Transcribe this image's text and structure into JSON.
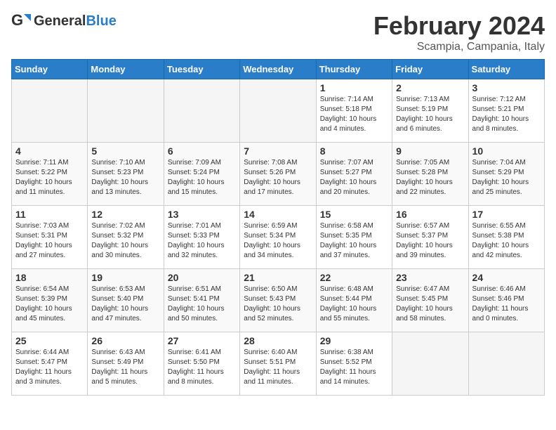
{
  "logo": {
    "text_general": "General",
    "text_blue": "Blue"
  },
  "title": "February 2024",
  "subtitle": "Scampia, Campania, Italy",
  "headers": [
    "Sunday",
    "Monday",
    "Tuesday",
    "Wednesday",
    "Thursday",
    "Friday",
    "Saturday"
  ],
  "weeks": [
    [
      {
        "day": "",
        "detail": ""
      },
      {
        "day": "",
        "detail": ""
      },
      {
        "day": "",
        "detail": ""
      },
      {
        "day": "",
        "detail": ""
      },
      {
        "day": "1",
        "detail": "Sunrise: 7:14 AM\nSunset: 5:18 PM\nDaylight: 10 hours\nand 4 minutes."
      },
      {
        "day": "2",
        "detail": "Sunrise: 7:13 AM\nSunset: 5:19 PM\nDaylight: 10 hours\nand 6 minutes."
      },
      {
        "day": "3",
        "detail": "Sunrise: 7:12 AM\nSunset: 5:21 PM\nDaylight: 10 hours\nand 8 minutes."
      }
    ],
    [
      {
        "day": "4",
        "detail": "Sunrise: 7:11 AM\nSunset: 5:22 PM\nDaylight: 10 hours\nand 11 minutes."
      },
      {
        "day": "5",
        "detail": "Sunrise: 7:10 AM\nSunset: 5:23 PM\nDaylight: 10 hours\nand 13 minutes."
      },
      {
        "day": "6",
        "detail": "Sunrise: 7:09 AM\nSunset: 5:24 PM\nDaylight: 10 hours\nand 15 minutes."
      },
      {
        "day": "7",
        "detail": "Sunrise: 7:08 AM\nSunset: 5:26 PM\nDaylight: 10 hours\nand 17 minutes."
      },
      {
        "day": "8",
        "detail": "Sunrise: 7:07 AM\nSunset: 5:27 PM\nDaylight: 10 hours\nand 20 minutes."
      },
      {
        "day": "9",
        "detail": "Sunrise: 7:05 AM\nSunset: 5:28 PM\nDaylight: 10 hours\nand 22 minutes."
      },
      {
        "day": "10",
        "detail": "Sunrise: 7:04 AM\nSunset: 5:29 PM\nDaylight: 10 hours\nand 25 minutes."
      }
    ],
    [
      {
        "day": "11",
        "detail": "Sunrise: 7:03 AM\nSunset: 5:31 PM\nDaylight: 10 hours\nand 27 minutes."
      },
      {
        "day": "12",
        "detail": "Sunrise: 7:02 AM\nSunset: 5:32 PM\nDaylight: 10 hours\nand 30 minutes."
      },
      {
        "day": "13",
        "detail": "Sunrise: 7:01 AM\nSunset: 5:33 PM\nDaylight: 10 hours\nand 32 minutes."
      },
      {
        "day": "14",
        "detail": "Sunrise: 6:59 AM\nSunset: 5:34 PM\nDaylight: 10 hours\nand 34 minutes."
      },
      {
        "day": "15",
        "detail": "Sunrise: 6:58 AM\nSunset: 5:35 PM\nDaylight: 10 hours\nand 37 minutes."
      },
      {
        "day": "16",
        "detail": "Sunrise: 6:57 AM\nSunset: 5:37 PM\nDaylight: 10 hours\nand 39 minutes."
      },
      {
        "day": "17",
        "detail": "Sunrise: 6:55 AM\nSunset: 5:38 PM\nDaylight: 10 hours\nand 42 minutes."
      }
    ],
    [
      {
        "day": "18",
        "detail": "Sunrise: 6:54 AM\nSunset: 5:39 PM\nDaylight: 10 hours\nand 45 minutes."
      },
      {
        "day": "19",
        "detail": "Sunrise: 6:53 AM\nSunset: 5:40 PM\nDaylight: 10 hours\nand 47 minutes."
      },
      {
        "day": "20",
        "detail": "Sunrise: 6:51 AM\nSunset: 5:41 PM\nDaylight: 10 hours\nand 50 minutes."
      },
      {
        "day": "21",
        "detail": "Sunrise: 6:50 AM\nSunset: 5:43 PM\nDaylight: 10 hours\nand 52 minutes."
      },
      {
        "day": "22",
        "detail": "Sunrise: 6:48 AM\nSunset: 5:44 PM\nDaylight: 10 hours\nand 55 minutes."
      },
      {
        "day": "23",
        "detail": "Sunrise: 6:47 AM\nSunset: 5:45 PM\nDaylight: 10 hours\nand 58 minutes."
      },
      {
        "day": "24",
        "detail": "Sunrise: 6:46 AM\nSunset: 5:46 PM\nDaylight: 11 hours\nand 0 minutes."
      }
    ],
    [
      {
        "day": "25",
        "detail": "Sunrise: 6:44 AM\nSunset: 5:47 PM\nDaylight: 11 hours\nand 3 minutes."
      },
      {
        "day": "26",
        "detail": "Sunrise: 6:43 AM\nSunset: 5:49 PM\nDaylight: 11 hours\nand 5 minutes."
      },
      {
        "day": "27",
        "detail": "Sunrise: 6:41 AM\nSunset: 5:50 PM\nDaylight: 11 hours\nand 8 minutes."
      },
      {
        "day": "28",
        "detail": "Sunrise: 6:40 AM\nSunset: 5:51 PM\nDaylight: 11 hours\nand 11 minutes."
      },
      {
        "day": "29",
        "detail": "Sunrise: 6:38 AM\nSunset: 5:52 PM\nDaylight: 11 hours\nand 14 minutes."
      },
      {
        "day": "",
        "detail": ""
      },
      {
        "day": "",
        "detail": ""
      }
    ]
  ]
}
